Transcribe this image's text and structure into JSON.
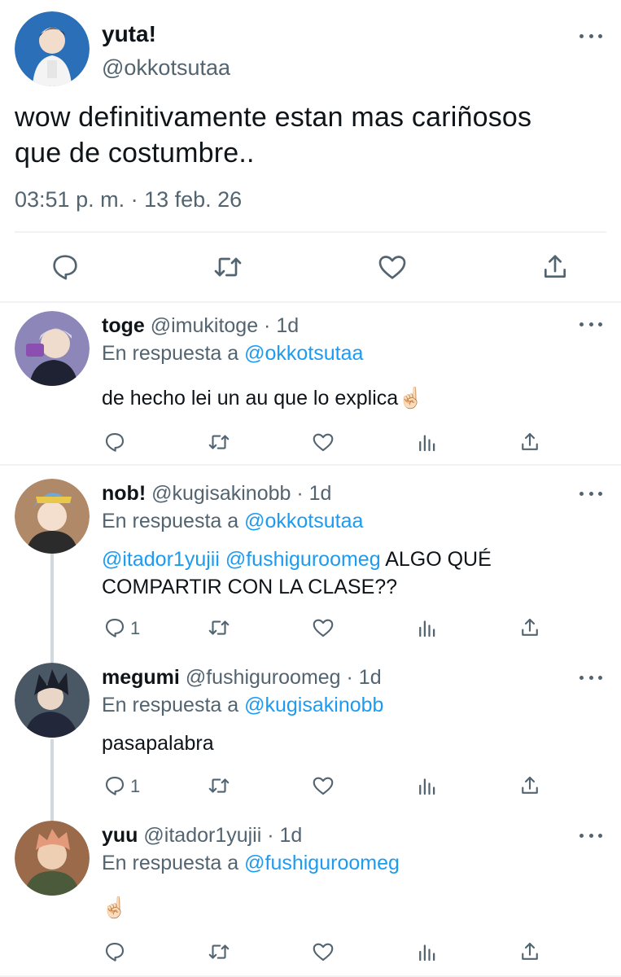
{
  "main_tweet": {
    "display_name": "yuta!",
    "handle": "@okkotsutaa",
    "text_line1": "wow definitivamente estan mas cariñosos",
    "text_line2": "que de costumbre..",
    "timestamp": "03:51 p. m. · 13 feb. 26",
    "avatar_color": "#2a6fb8"
  },
  "replies": [
    {
      "display_name": "toge",
      "handle": "@imukitoge · 1d",
      "replying_label": "En respuesta a",
      "replying_to": "@okkotsutaa",
      "text": "de hecho lei un au que lo explica",
      "emoji": "☝🏻",
      "reply_count": "",
      "avatar_color": "#7a6fa8"
    },
    {
      "display_name": "nob!",
      "handle": "@kugisakinobb · 1d",
      "replying_label": "En respuesta a",
      "replying_to": "@okkotsutaa",
      "mention1": "@itador1yujii",
      "mention2": "@fushiguroomeg",
      "text_after": "ALGO QUÉ",
      "text_line2": "COMPARTIR CON LA CLASE??",
      "reply_count": "1",
      "avatar_color": "#c98a5a"
    },
    {
      "display_name": "megumi",
      "handle": "@fushiguroomeg · 1d",
      "replying_label": "En respuesta a",
      "replying_to": "@kugisakinobb",
      "text": "pasapalabra",
      "reply_count": "1",
      "avatar_color": "#3a4a5a"
    },
    {
      "display_name": "yuu",
      "handle": "@itador1yujii · 1d",
      "replying_label": "En respuesta a",
      "replying_to": "@fushiguroomeg",
      "emoji": "☝🏻",
      "reply_count": "",
      "avatar_color": "#b86a4a"
    }
  ],
  "icons": {
    "reply": "reply-icon",
    "retweet": "retweet-icon",
    "like": "like-icon",
    "share": "share-icon",
    "analytics": "analytics-icon",
    "more": "more-icon"
  },
  "colors": {
    "link": "#1d9bf0",
    "muted": "#536471",
    "divider": "#eff3f4"
  }
}
